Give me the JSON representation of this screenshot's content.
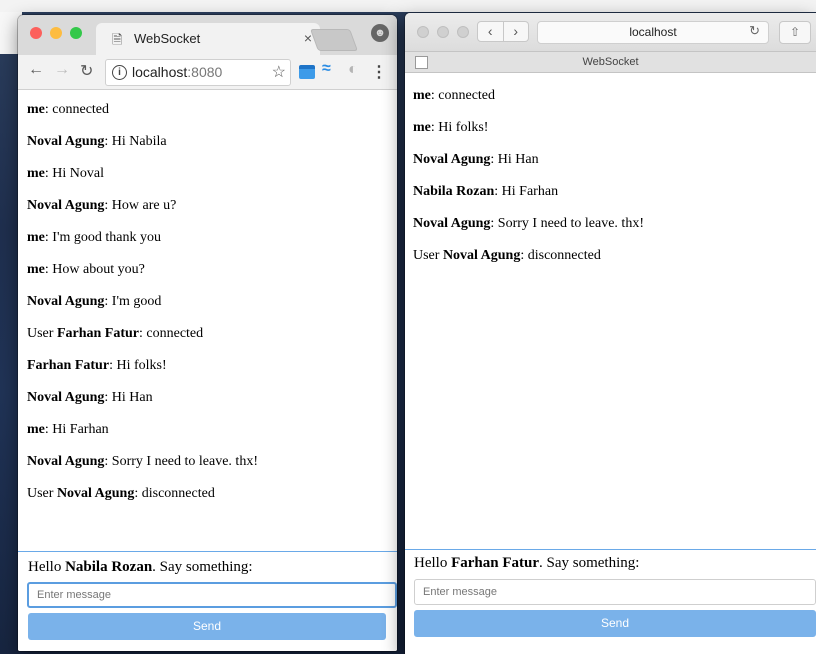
{
  "chrome": {
    "tab_title": "WebSocket",
    "tab_close": "×",
    "url_host": "localhost",
    "url_port": ":8080",
    "messages": [
      {
        "sender": "me",
        "text": ": connected",
        "prefix": ""
      },
      {
        "sender": "Noval Agung",
        "text": ": Hi Nabila",
        "prefix": ""
      },
      {
        "sender": "me",
        "text": ": Hi Noval",
        "prefix": ""
      },
      {
        "sender": "Noval Agung",
        "text": ": How are u?",
        "prefix": ""
      },
      {
        "sender": "me",
        "text": ": I'm good thank you",
        "prefix": ""
      },
      {
        "sender": "me",
        "text": ": How about you?",
        "prefix": ""
      },
      {
        "sender": "Noval Agung",
        "text": ": I'm good",
        "prefix": ""
      },
      {
        "sender": "Farhan Fatur",
        "text": ": connected",
        "prefix": "User "
      },
      {
        "sender": "Farhan Fatur",
        "text": ": Hi folks!",
        "prefix": ""
      },
      {
        "sender": "Noval Agung",
        "text": ": Hi Han",
        "prefix": ""
      },
      {
        "sender": "me",
        "text": ": Hi Farhan",
        "prefix": ""
      },
      {
        "sender": "Noval Agung",
        "text": ": Sorry I need to leave. thx!",
        "prefix": ""
      },
      {
        "sender": "Noval Agung",
        "text": ": disconnected",
        "prefix": "User "
      }
    ],
    "hello_prefix": "Hello ",
    "user_name": "Nabila Rozan",
    "hello_suffix": ". Say something:",
    "input_placeholder": "Enter message",
    "send_label": "Send"
  },
  "safari": {
    "address": "localhost",
    "tab_title": "WebSocket",
    "messages": [
      {
        "sender": "me",
        "text": ": connected",
        "prefix": ""
      },
      {
        "sender": "me",
        "text": ": Hi folks!",
        "prefix": ""
      },
      {
        "sender": "Noval Agung",
        "text": ": Hi Han",
        "prefix": ""
      },
      {
        "sender": "Nabila Rozan",
        "text": ": Hi Farhan",
        "prefix": ""
      },
      {
        "sender": "Noval Agung",
        "text": ": Sorry I need to leave. thx!",
        "prefix": ""
      },
      {
        "sender": "Noval Agung",
        "text": ": disconnected",
        "prefix": "User "
      }
    ],
    "hello_prefix": "Hello ",
    "user_name": "Farhan Fatur",
    "hello_suffix": ". Say something:",
    "input_placeholder": "Enter message",
    "send_label": "Send"
  },
  "colors": {
    "accent_button": "#7ab2ea",
    "input_focus": "#5b9de0",
    "light_red": "#fc605c",
    "light_yellow": "#fdbc40",
    "light_green": "#34c84a"
  }
}
